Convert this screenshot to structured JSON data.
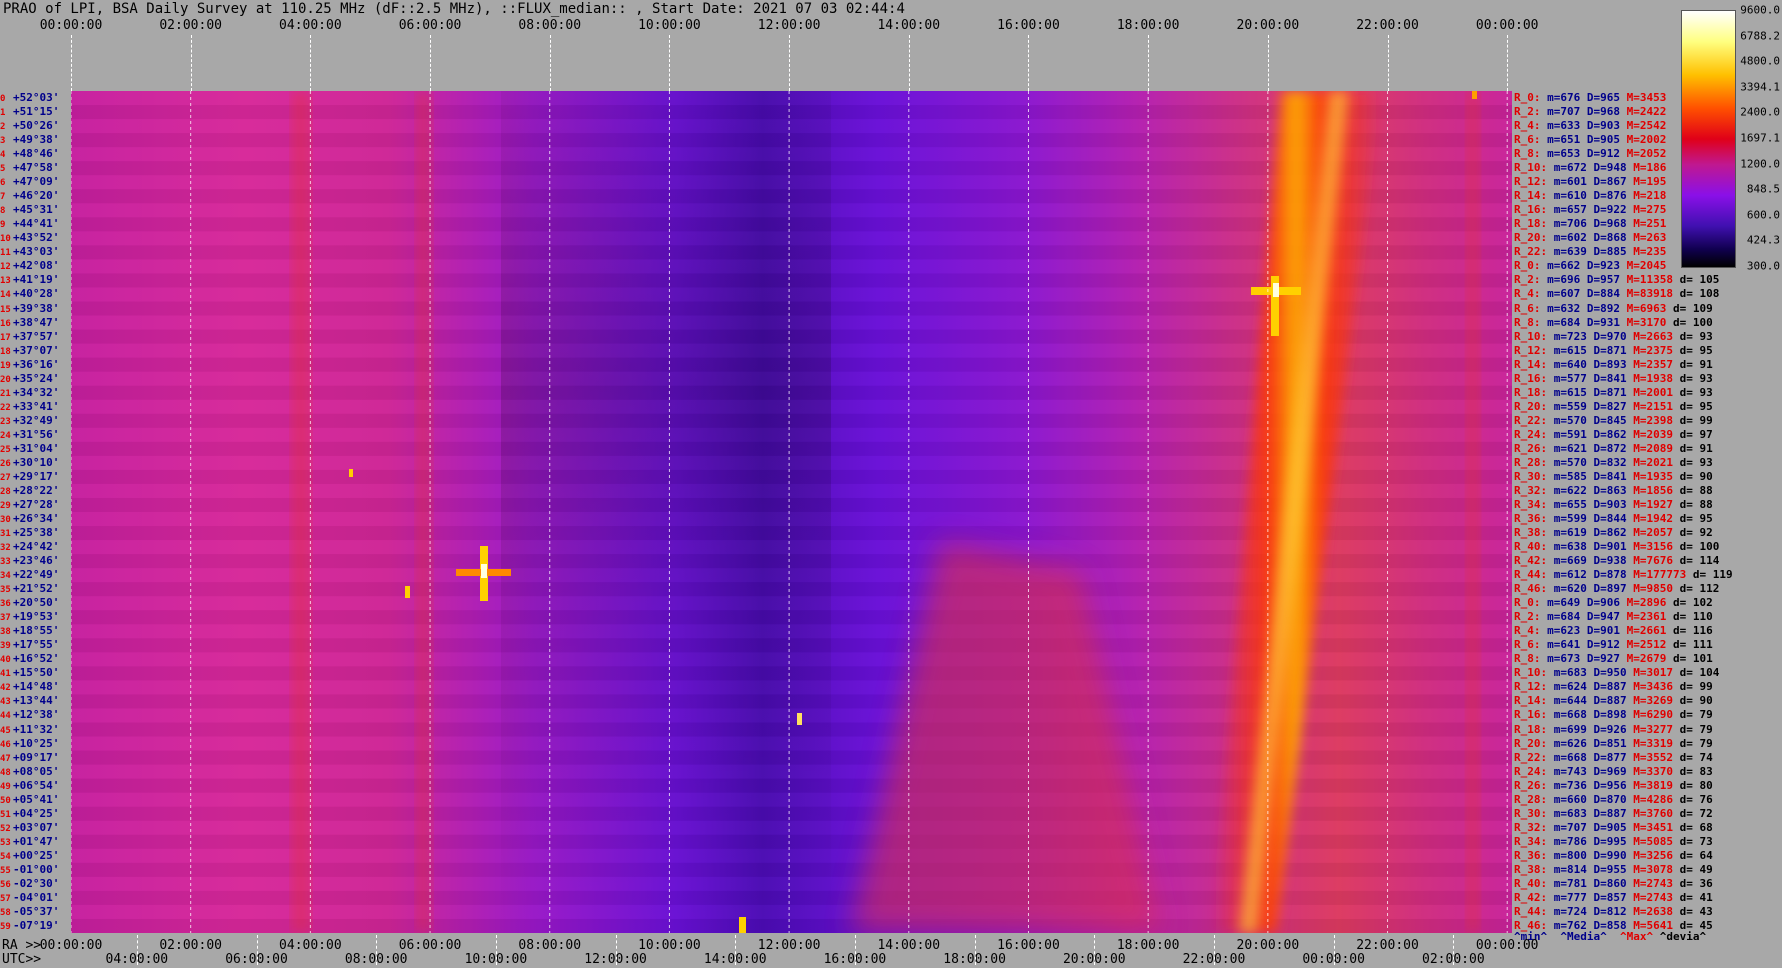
{
  "title": "PRAO of LPI, BSA Daily Survey at 110.25 MHz (dF::2.5 MHz), ::FLUX_median:: , Start Date: 2021 07 03 02:44:4",
  "ra_label": "RA >>",
  "utc_label": "UTC>>",
  "colors": {
    "background": "#a8a8a8",
    "index_red": "#e00000",
    "value_navy": "#00008b"
  },
  "chart_data": {
    "type": "heatmap",
    "title": "PRAO of LPI, BSA Daily Survey at 110.25 MHz (dF::2.5 MHz), ::FLUX_median:: , Start Date: 2021 07 03 02:44:4",
    "x_top_ticks": [
      "00:00:00",
      "02:00:00",
      "04:00:00",
      "06:00:00",
      "08:00:00",
      "10:00:00",
      "12:00:00",
      "14:00:00",
      "16:00:00",
      "18:00:00",
      "20:00:00",
      "22:00:00",
      "00:00:00"
    ],
    "x_ra_ticks": [
      "00:00:00",
      "02:00:00",
      "04:00:00",
      "06:00:00",
      "08:00:00",
      "10:00:00",
      "12:00:00",
      "14:00:00",
      "16:00:00",
      "18:00:00",
      "20:00:00",
      "22:00:00",
      "00:00:00"
    ],
    "x_utc_ticks": [
      "04:00:00",
      "06:00:00",
      "08:00:00",
      "10:00:00",
      "12:00:00",
      "14:00:00",
      "16:00:00",
      "18:00:00",
      "20:00:00",
      "22:00:00",
      "00:00:00",
      "02:00:00"
    ],
    "colorbar_ticks": [
      "9600.0",
      "6788.2",
      "4800.0",
      "3394.1",
      "2400.0",
      "1697.1",
      "1200.0",
      "848.5",
      "600.0",
      "424.3",
      "300.0"
    ],
    "scale": "log",
    "grid": true,
    "rows": [
      {
        "idx": "0",
        "dec": "+52°03'"
      },
      {
        "idx": "1",
        "dec": "+51°15'"
      },
      {
        "idx": "2",
        "dec": "+50°26'"
      },
      {
        "idx": "3",
        "dec": "+49°38'"
      },
      {
        "idx": "4",
        "dec": "+48°46'"
      },
      {
        "idx": "5",
        "dec": "+47°58'"
      },
      {
        "idx": "6",
        "dec": "+47°09'"
      },
      {
        "idx": "7",
        "dec": "+46°20'"
      },
      {
        "idx": "8",
        "dec": "+45°31'"
      },
      {
        "idx": "9",
        "dec": "+44°41'"
      },
      {
        "idx": "10",
        "dec": "+43°52'"
      },
      {
        "idx": "11",
        "dec": "+43°03'"
      },
      {
        "idx": "12",
        "dec": "+42°08'"
      },
      {
        "idx": "13",
        "dec": "+41°19'"
      },
      {
        "idx": "14",
        "dec": "+40°28'"
      },
      {
        "idx": "15",
        "dec": "+39°38'"
      },
      {
        "idx": "16",
        "dec": "+38°47'"
      },
      {
        "idx": "17",
        "dec": "+37°57'"
      },
      {
        "idx": "18",
        "dec": "+37°07'"
      },
      {
        "idx": "19",
        "dec": "+36°16'"
      },
      {
        "idx": "20",
        "dec": "+35°24'"
      },
      {
        "idx": "21",
        "dec": "+34°32'"
      },
      {
        "idx": "22",
        "dec": "+33°41'"
      },
      {
        "idx": "23",
        "dec": "+32°49'"
      },
      {
        "idx": "24",
        "dec": "+31°56'"
      },
      {
        "idx": "25",
        "dec": "+31°04'"
      },
      {
        "idx": "26",
        "dec": "+30°10'"
      },
      {
        "idx": "27",
        "dec": "+29°17'"
      },
      {
        "idx": "28",
        "dec": "+28°22'"
      },
      {
        "idx": "29",
        "dec": "+27°28'"
      },
      {
        "idx": "30",
        "dec": "+26°34'"
      },
      {
        "idx": "31",
        "dec": "+25°38'"
      },
      {
        "idx": "32",
        "dec": "+24°42'"
      },
      {
        "idx": "33",
        "dec": "+23°46'"
      },
      {
        "idx": "34",
        "dec": "+22°49'"
      },
      {
        "idx": "35",
        "dec": "+21°52'"
      },
      {
        "idx": "36",
        "dec": "+20°50'"
      },
      {
        "idx": "37",
        "dec": "+19°53'"
      },
      {
        "idx": "38",
        "dec": "+18°55'"
      },
      {
        "idx": "39",
        "dec": "+17°55'"
      },
      {
        "idx": "40",
        "dec": "+16°52'"
      },
      {
        "idx": "41",
        "dec": "+15°50'"
      },
      {
        "idx": "42",
        "dec": "+14°48'"
      },
      {
        "idx": "43",
        "dec": "+13°44'"
      },
      {
        "idx": "44",
        "dec": "+12°38'"
      },
      {
        "idx": "45",
        "dec": "+11°32'"
      },
      {
        "idx": "46",
        "dec": "+10°25'"
      },
      {
        "idx": "47",
        "dec": "+09°17'"
      },
      {
        "idx": "48",
        "dec": "+08°05'"
      },
      {
        "idx": "49",
        "dec": "+06°54'"
      },
      {
        "idx": "50",
        "dec": "+05°41'"
      },
      {
        "idx": "51",
        "dec": "+04°25'"
      },
      {
        "idx": "52",
        "dec": "+03°07'"
      },
      {
        "idx": "53",
        "dec": "+01°47'"
      },
      {
        "idx": "54",
        "dec": "+00°25'"
      },
      {
        "idx": "55",
        "dec": "-01°00'"
      },
      {
        "idx": "56",
        "dec": "-02°30'"
      },
      {
        "idx": "57",
        "dec": "-04°01'"
      },
      {
        "idx": "58",
        "dec": "-05°37'"
      },
      {
        "idx": "59",
        "dec": "-07°19'"
      }
    ],
    "stats": [
      {
        "r": "R_0:",
        "m": "676",
        "D": "965",
        "M": "3453",
        "d": ""
      },
      {
        "r": "R_2:",
        "m": "707",
        "D": "968",
        "M": "2422",
        "d": ""
      },
      {
        "r": "R_4:",
        "m": "633",
        "D": "903",
        "M": "2542",
        "d": ""
      },
      {
        "r": "R_6:",
        "m": "651",
        "D": "905",
        "M": "2002",
        "d": ""
      },
      {
        "r": "R_8:",
        "m": "653",
        "D": "912",
        "M": "2052",
        "d": ""
      },
      {
        "r": "R_10:",
        "m": "672",
        "D": "948",
        "M": "186",
        "d": ""
      },
      {
        "r": "R_12:",
        "m": "601",
        "D": "867",
        "M": "195",
        "d": ""
      },
      {
        "r": "R_14:",
        "m": "610",
        "D": "876",
        "M": "218",
        "d": ""
      },
      {
        "r": "R_16:",
        "m": "657",
        "D": "922",
        "M": "275",
        "d": ""
      },
      {
        "r": "R_18:",
        "m": "706",
        "D": "968",
        "M": "251",
        "d": ""
      },
      {
        "r": "R_20:",
        "m": "602",
        "D": "868",
        "M": "263",
        "d": ""
      },
      {
        "r": "R_22:",
        "m": "639",
        "D": "885",
        "M": "235",
        "d": ""
      },
      {
        "r": "R_0:",
        "m": "662",
        "D": "923",
        "M": "2045",
        "d": ""
      },
      {
        "r": "R_2:",
        "m": "696",
        "D": "957",
        "M": "11358",
        "d": "105"
      },
      {
        "r": "R_4:",
        "m": "607",
        "D": "884",
        "M": "83918",
        "d": "108"
      },
      {
        "r": "R_6:",
        "m": "632",
        "D": "892",
        "M": "6963",
        "d": "109"
      },
      {
        "r": "R_8:",
        "m": "684",
        "D": "931",
        "M": "3170",
        "d": "100"
      },
      {
        "r": "R_10:",
        "m": "723",
        "D": "970",
        "M": "2663",
        "d": "93"
      },
      {
        "r": "R_12:",
        "m": "615",
        "D": "871",
        "M": "2375",
        "d": "95"
      },
      {
        "r": "R_14:",
        "m": "640",
        "D": "893",
        "M": "2357",
        "d": "91"
      },
      {
        "r": "R_16:",
        "m": "577",
        "D": "841",
        "M": "1938",
        "d": "93"
      },
      {
        "r": "R_18:",
        "m": "615",
        "D": "871",
        "M": "2001",
        "d": "93"
      },
      {
        "r": "R_20:",
        "m": "559",
        "D": "827",
        "M": "2151",
        "d": "95"
      },
      {
        "r": "R_22:",
        "m": "570",
        "D": "845",
        "M": "2398",
        "d": "99"
      },
      {
        "r": "R_24:",
        "m": "591",
        "D": "862",
        "M": "2039",
        "d": "97"
      },
      {
        "r": "R_26:",
        "m": "621",
        "D": "872",
        "M": "2089",
        "d": "91"
      },
      {
        "r": "R_28:",
        "m": "570",
        "D": "832",
        "M": "2021",
        "d": "93"
      },
      {
        "r": "R_30:",
        "m": "585",
        "D": "841",
        "M": "1935",
        "d": "90"
      },
      {
        "r": "R_32:",
        "m": "622",
        "D": "863",
        "M": "1856",
        "d": "88"
      },
      {
        "r": "R_34:",
        "m": "655",
        "D": "903",
        "M": "1927",
        "d": "88"
      },
      {
        "r": "R_36:",
        "m": "599",
        "D": "844",
        "M": "1942",
        "d": "95"
      },
      {
        "r": "R_38:",
        "m": "619",
        "D": "862",
        "M": "2057",
        "d": "92"
      },
      {
        "r": "R_40:",
        "m": "638",
        "D": "901",
        "M": "3156",
        "d": "100"
      },
      {
        "r": "R_42:",
        "m": "669",
        "D": "938",
        "M": "7676",
        "d": "114"
      },
      {
        "r": "R_44:",
        "m": "612",
        "D": "878",
        "M": "177773",
        "d": "119"
      },
      {
        "r": "R_46:",
        "m": "620",
        "D": "897",
        "M": "9850",
        "d": "112"
      },
      {
        "r": "R_0:",
        "m": "649",
        "D": "906",
        "M": "2896",
        "d": "102"
      },
      {
        "r": "R_2:",
        "m": "684",
        "D": "947",
        "M": "2361",
        "d": "110"
      },
      {
        "r": "R_4:",
        "m": "623",
        "D": "901",
        "M": "2661",
        "d": "116"
      },
      {
        "r": "R_6:",
        "m": "641",
        "D": "912",
        "M": "2512",
        "d": "111"
      },
      {
        "r": "R_8:",
        "m": "673",
        "D": "927",
        "M": "2679",
        "d": "101"
      },
      {
        "r": "R_10:",
        "m": "683",
        "D": "950",
        "M": "3017",
        "d": "104"
      },
      {
        "r": "R_12:",
        "m": "624",
        "D": "887",
        "M": "3436",
        "d": "99"
      },
      {
        "r": "R_14:",
        "m": "644",
        "D": "887",
        "M": "3269",
        "d": "90"
      },
      {
        "r": "R_16:",
        "m": "668",
        "D": "898",
        "M": "6290",
        "d": "79"
      },
      {
        "r": "R_18:",
        "m": "699",
        "D": "926",
        "M": "3277",
        "d": "79"
      },
      {
        "r": "R_20:",
        "m": "626",
        "D": "851",
        "M": "3319",
        "d": "79"
      },
      {
        "r": "R_22:",
        "m": "668",
        "D": "877",
        "M": "3552",
        "d": "74"
      },
      {
        "r": "R_24:",
        "m": "743",
        "D": "969",
        "M": "3370",
        "d": "83"
      },
      {
        "r": "R_26:",
        "m": "736",
        "D": "956",
        "M": "3819",
        "d": "80"
      },
      {
        "r": "R_28:",
        "m": "660",
        "D": "870",
        "M": "4286",
        "d": "76"
      },
      {
        "r": "R_30:",
        "m": "683",
        "D": "887",
        "M": "3760",
        "d": "72"
      },
      {
        "r": "R_32:",
        "m": "707",
        "D": "905",
        "M": "3451",
        "d": "68"
      },
      {
        "r": "R_34:",
        "m": "786",
        "D": "995",
        "M": "5085",
        "d": "73"
      },
      {
        "r": "R_36:",
        "m": "800",
        "D": "990",
        "M": "3256",
        "d": "64"
      },
      {
        "r": "R_38:",
        "m": "814",
        "D": "955",
        "M": "3078",
        "d": "49"
      },
      {
        "r": "R_40:",
        "m": "781",
        "D": "860",
        "M": "2743",
        "d": "36"
      },
      {
        "r": "R_42:",
        "m": "777",
        "D": "857",
        "M": "2743",
        "d": "41"
      },
      {
        "r": "R_44:",
        "m": "724",
        "D": "812",
        "M": "2638",
        "d": "43"
      },
      {
        "r": "R_46:",
        "m": "762",
        "D": "858",
        "M": "5641",
        "d": "45"
      }
    ],
    "stats_footer": {
      "min": "^min^",
      "media": "^Media^",
      "max": "^Max^",
      "devia": "^devia^"
    }
  }
}
